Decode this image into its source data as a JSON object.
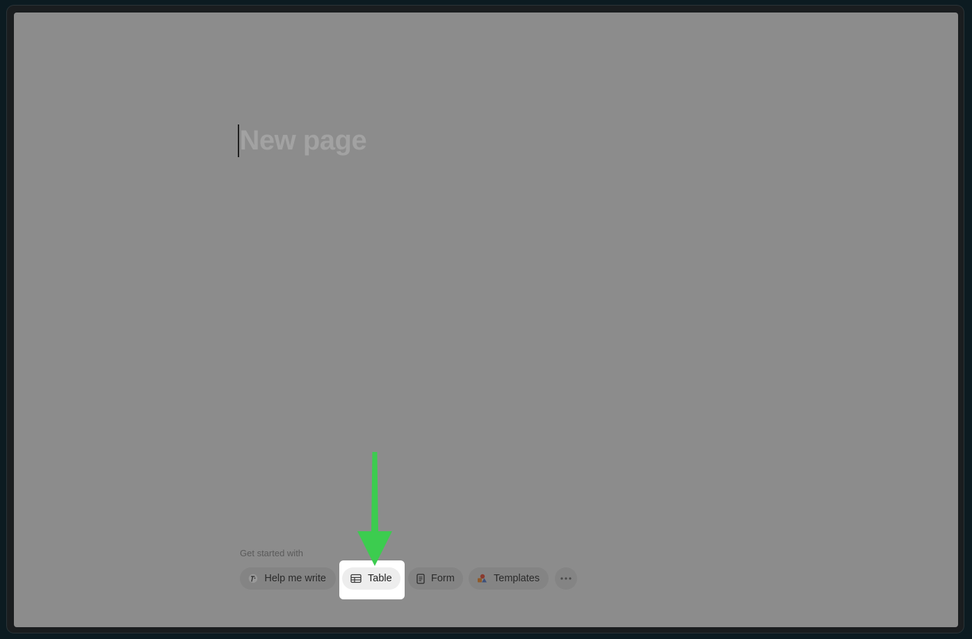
{
  "page": {
    "title_placeholder": "New page"
  },
  "get_started": {
    "label": "Get started with",
    "actions": [
      {
        "label": "Help me write",
        "icon": "ai-pen-icon"
      },
      {
        "label": "Table",
        "icon": "table-icon"
      },
      {
        "label": "Form",
        "icon": "form-icon"
      },
      {
        "label": "Templates",
        "icon": "templates-icon"
      },
      {
        "label": "",
        "icon": "more-dots-icon"
      }
    ]
  },
  "annotation": {
    "highlight_target": "Table",
    "arrow_color": "#3ccc4f"
  },
  "colors": {
    "overlay": "#8c8c8c",
    "highlight": "#ffffff",
    "frame": "#1a1d1f"
  }
}
